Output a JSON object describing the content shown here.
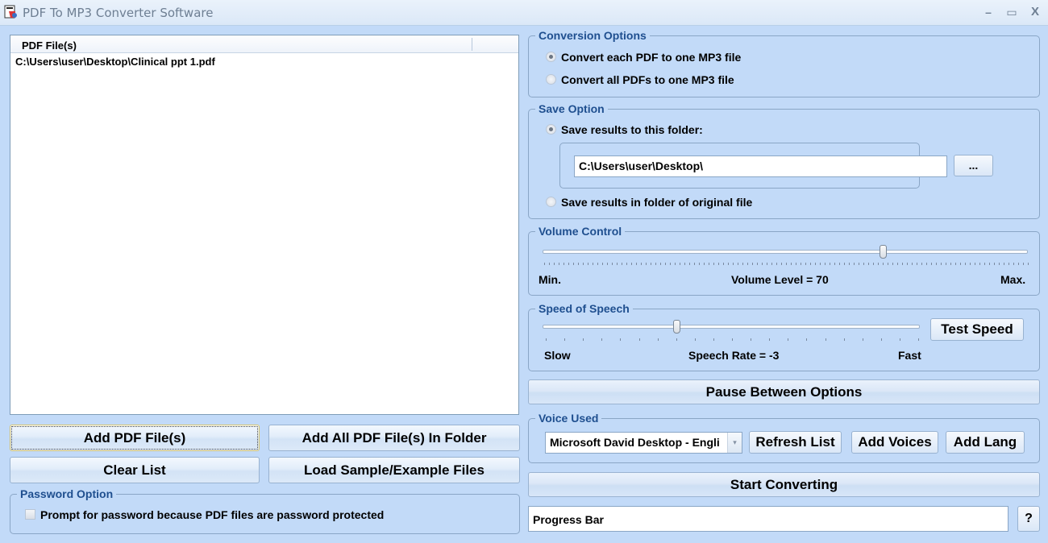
{
  "window": {
    "title": "PDF To MP3 Converter Software",
    "controls": {
      "minimize": "–",
      "maximize": "▭",
      "close": "X"
    }
  },
  "file_list": {
    "column_header": "PDF File(s)",
    "files": [
      "C:\\Users\\user\\Desktop\\Clinical ppt 1.pdf"
    ]
  },
  "buttons": {
    "add_pdf": "Add PDF File(s)",
    "add_all_in_folder": "Add All PDF File(s) In Folder",
    "clear_list": "Clear List",
    "load_sample": "Load Sample/Example Files",
    "browse": "...",
    "test_speed": "Test Speed",
    "pause_between_options": "Pause Between Options",
    "refresh_list": "Refresh List",
    "add_voices": "Add Voices",
    "add_lang": "Add Lang",
    "start_converting": "Start Converting",
    "help": "?"
  },
  "password_option": {
    "legend": "Password Option",
    "checkbox_label": "Prompt for password because PDF files are password protected",
    "checked": false
  },
  "conversion_options": {
    "legend": "Conversion Options",
    "options": [
      {
        "label": "Convert each PDF to one MP3 file",
        "selected": true
      },
      {
        "label": "Convert all PDFs to one MP3 file",
        "selected": false
      }
    ]
  },
  "save_option": {
    "legend": "Save Option",
    "options": [
      {
        "label": "Save results to this folder:",
        "selected": true
      },
      {
        "label": "Save results in folder of original file",
        "selected": false
      }
    ],
    "folder_path": "C:\\Users\\user\\Desktop\\"
  },
  "volume_control": {
    "legend": "Volume Control",
    "min_label": "Min.",
    "max_label": "Max.",
    "level_text": "Volume Level = 70",
    "value": 70,
    "min": 0,
    "max": 100
  },
  "speed_of_speech": {
    "legend": "Speed of Speech",
    "slow_label": "Slow",
    "fast_label": "Fast",
    "rate_text": "Speech Rate = -3",
    "value": -3,
    "min": -10,
    "max": 10
  },
  "voice_used": {
    "legend": "Voice Used",
    "selected_voice": "Microsoft David Desktop - Engli"
  },
  "progress": {
    "label": "Progress Bar"
  },
  "icons": {
    "app": "pdf-to-mp3-app-icon",
    "combo_arrow": "▾"
  }
}
